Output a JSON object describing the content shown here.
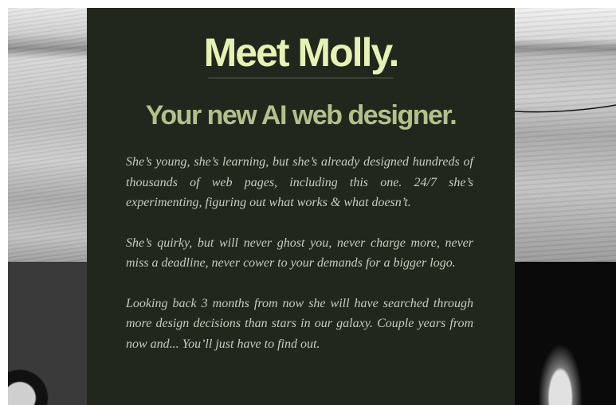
{
  "hero": {
    "headline": "Meet Molly.",
    "subheadline": "Your new AI web designer."
  },
  "body": {
    "paragraphs": [
      "She’s young, she’s learning, but she’s already designed hundreds of thousands of web pages, including this one. 24/7 she’s experimenting, figuring out what works & what doesn’t.",
      "She’s quirky, but will never ghost you, never charge more, never miss a deadline, never cower to your demands for a bigger logo.",
      "Looking back 3 months from now she will have searched through more design decisions than stars in our galaxy. Couple years from now and... You’ll just have to find out."
    ]
  },
  "colors": {
    "panel_background": "#22271e",
    "headline": "#e6f2b3",
    "subheadline": "#b4c08c",
    "body_text": "#c7ccbc"
  }
}
